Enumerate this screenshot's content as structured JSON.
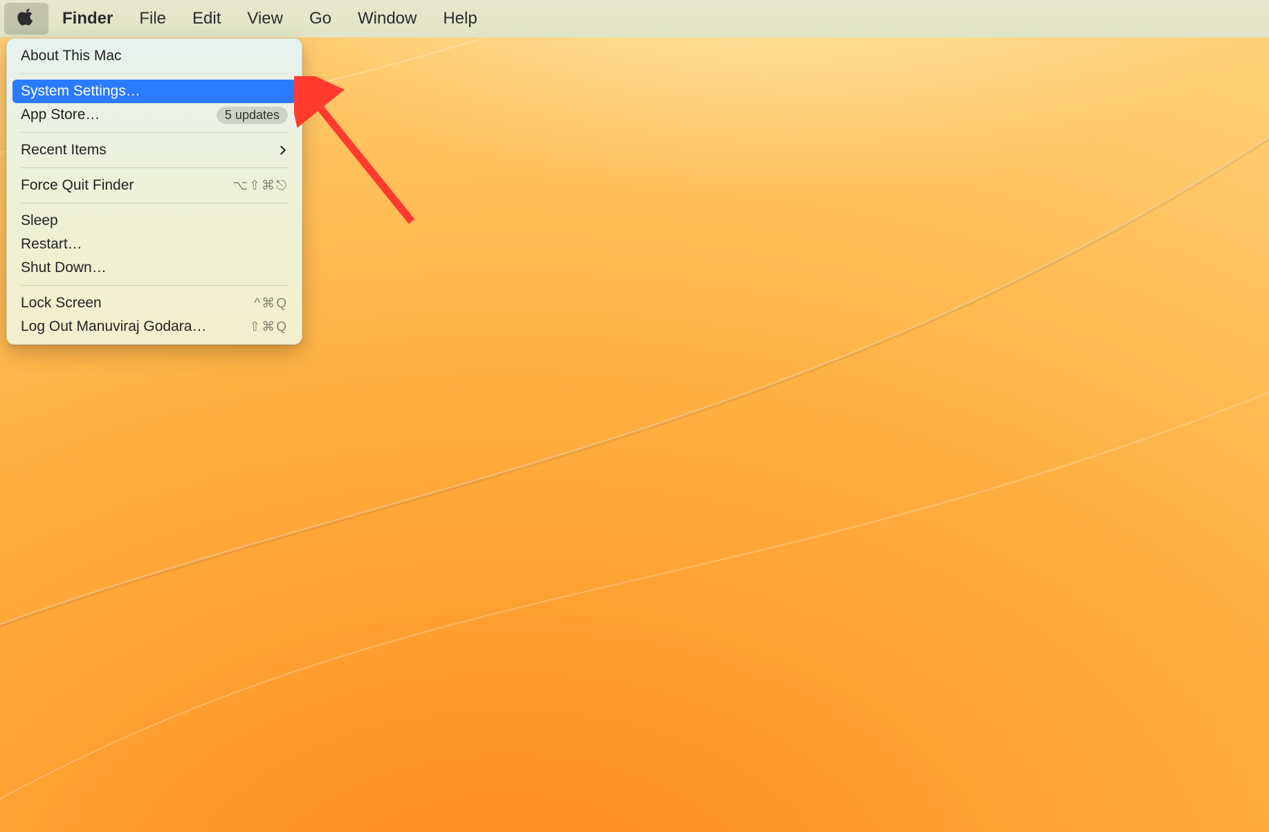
{
  "menubar": {
    "app_name": "Finder",
    "items": [
      "File",
      "Edit",
      "View",
      "Go",
      "Window",
      "Help"
    ]
  },
  "apple_menu": {
    "about": "About This Mac",
    "system_settings": "System Settings…",
    "app_store": "App Store…",
    "app_store_badge": "5 updates",
    "recent_items": "Recent Items",
    "force_quit": "Force Quit Finder",
    "force_quit_shortcut": "⌥⇧⌘⎋",
    "sleep": "Sleep",
    "restart": "Restart…",
    "shutdown": "Shut Down…",
    "lock_screen": "Lock Screen",
    "lock_screen_shortcut": "^⌘Q",
    "log_out": "Log Out Manuviraj Godara…",
    "log_out_shortcut": "⇧⌘Q"
  }
}
